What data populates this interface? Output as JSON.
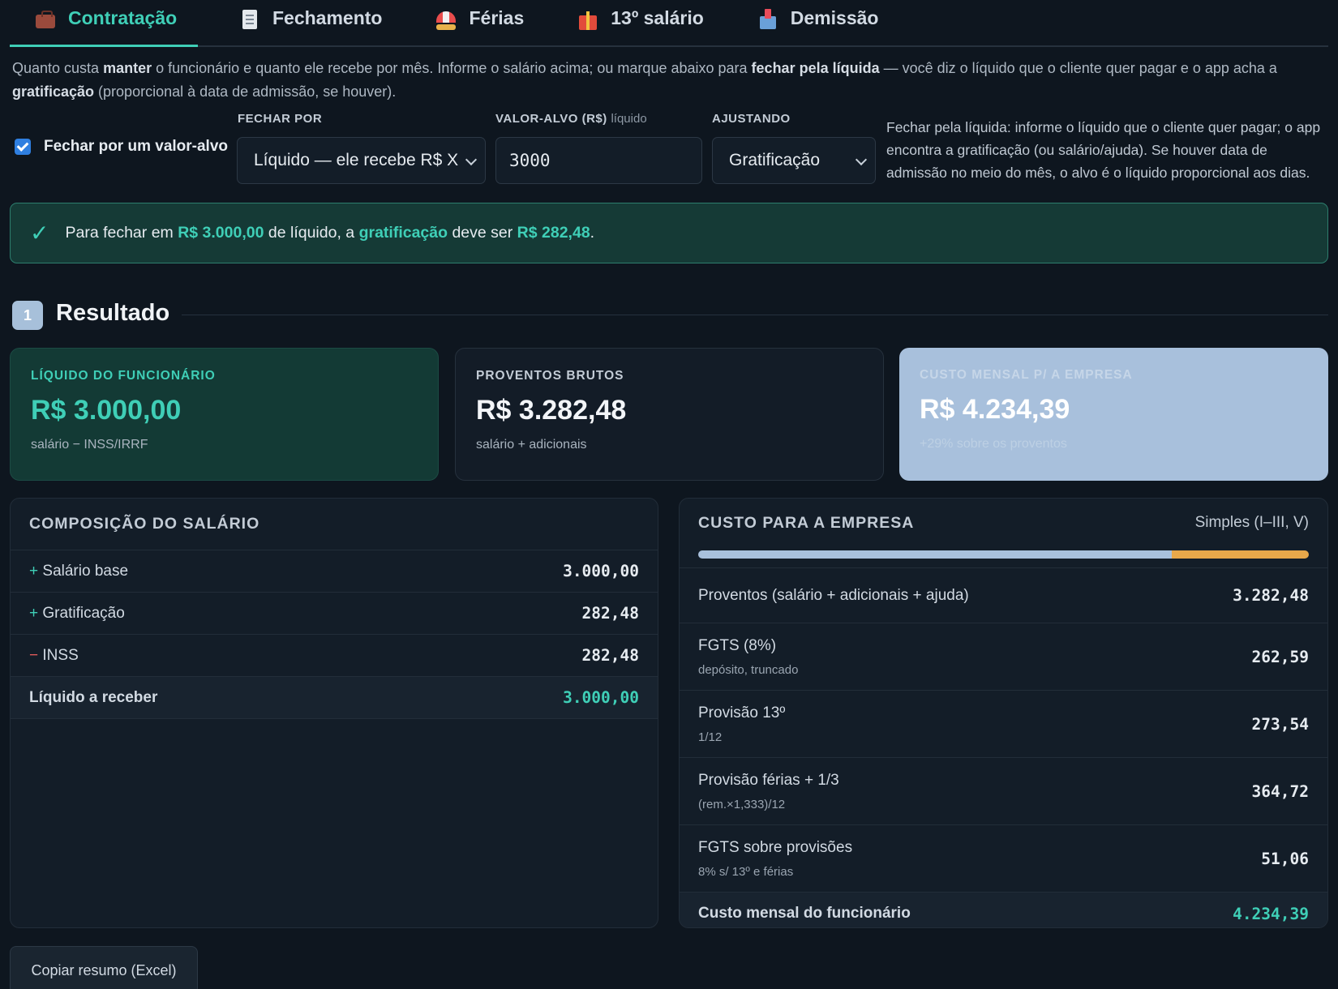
{
  "tabs": [
    {
      "label": "Contratação",
      "icon": "briefcase-icon",
      "active": true
    },
    {
      "label": "Fechamento",
      "icon": "receipt-icon"
    },
    {
      "label": "Férias",
      "icon": "beach-umbrella-icon"
    },
    {
      "label": "13º salário",
      "icon": "gift-icon"
    },
    {
      "label": "Demissão",
      "icon": "outbox-icon"
    }
  ],
  "intro": {
    "p1": "Quanto custa ",
    "b1": "manter",
    "p2": " o funcionário e quanto ele recebe por mês. Informe o salário acima; ou marque abaixo para ",
    "b2": "fechar pela líquida",
    "p3": " — você diz o líquido que o cliente quer pagar e o app acha a ",
    "b3": "gratificação",
    "p4": " (proporcional à data de admissão, se houver)."
  },
  "target": {
    "checkbox_label": "Fechar por um valor-alvo",
    "checked": true,
    "fechar_por_label": "FECHAR POR",
    "fechar_por_value": "Líquido — ele recebe R$ X",
    "valor_alvo_label": "VALOR-ALVO (R$)",
    "valor_alvo_hint": "líquido",
    "valor_alvo_value": "3000",
    "ajustando_label": "AJUSTANDO",
    "ajustando_value": "Gratificação",
    "help": "Fechar pela líquida: informe o líquido que o cliente quer pagar; o app encontra a gratificação (ou salário/ajuda). Se houver data de admissão no meio do mês, o alvo é o líquido proporcional aos dias."
  },
  "banner": {
    "pre": "Para fechar em ",
    "amount": "R$ 3.000,00",
    "mid1": " de líquido, a ",
    "field": "gratificação",
    "mid2": " deve ser ",
    "result": "R$ 282,48",
    "end": "."
  },
  "section": {
    "number": "1",
    "title": "Resultado"
  },
  "cards": {
    "net": {
      "label": "LÍQUIDO DO FUNCIONÁRIO",
      "value": "R$ 3.000,00",
      "sub": "salário − INSS/IRRF"
    },
    "gross": {
      "label": "PROVENTOS BRUTOS",
      "value": "R$ 3.282,48",
      "sub": "salário + adicionais"
    },
    "cost": {
      "label": "CUSTO MENSAL P/ A EMPRESA",
      "value": "R$ 4.234,39",
      "sub": "+29% sobre os proventos"
    }
  },
  "composition": {
    "title": "COMPOSIÇÃO DO SALÁRIO",
    "rows": [
      {
        "sign": "+",
        "label": "Salário base",
        "value": "3.000,00"
      },
      {
        "sign": "+",
        "label": "Gratificação",
        "value": "282,48"
      },
      {
        "sign": "−",
        "label": "INSS",
        "value": "282,48"
      }
    ],
    "total_label": "Líquido a receber",
    "total_value": "3.000,00"
  },
  "company_cost": {
    "title": "CUSTO PARA A EMPRESA",
    "regime": "Simples (I–III, V)",
    "bar_fraction": 0.775,
    "rows": [
      {
        "label": "Proventos (salário + adicionais + ajuda)",
        "sub": "",
        "value": "3.282,48"
      },
      {
        "label": "FGTS (8%)",
        "sub": "depósito, truncado",
        "value": "262,59"
      },
      {
        "label": "Provisão 13º",
        "sub": "1/12",
        "value": "273,54"
      },
      {
        "label": "Provisão férias + 1/3",
        "sub": "(rem.×1,333)/12",
        "value": "364,72"
      },
      {
        "label": "FGTS sobre provisões",
        "sub": "8% s/ 13º e férias",
        "value": "51,06"
      }
    ],
    "total_label": "Custo mensal do funcionário",
    "total_value": "4.234,39"
  },
  "copy_button": "Copiar resumo (Excel)",
  "colors": {
    "accent": "#3fcfb7",
    "cost": "#a8c0dc",
    "bar_tax": "#e8a84a"
  }
}
